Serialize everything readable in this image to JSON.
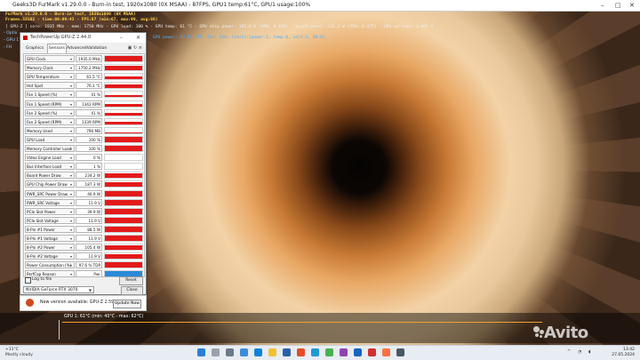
{
  "furmark": {
    "title": "Geeks3D FurMark v1.29.0.0 - Burn-in test, 1920x1080 (0X MSAA) - 87FPS, GPU1 temp:61°C, GPU1 usage:100%",
    "osd_line1": "FurMark v1.29.0.0 - Burn-in test, 1920x1080 (0X MSAA)",
    "osd_line2": "Frames:58102 - time:00:09:43 - FPS:87 (min:67, max:99, avg:86)",
    "osd_line3": "[ GPU-Z ] core: 1935 MHz - mem: 1750 MHz - GPU load: 100 % - GPU temp: 61 °C - GPU chip power: 185.8 W (PPW: 0.468) - Board power: 232.2 W (PPW: 0.375) - GPU voltage: 1.005 V",
    "osd_line4": "GPU power: 97.6% TDP, fan: 41%, limits:[power:1, temp:0, volt:1, OV:0]",
    "side_items": [
      "- Optix",
      "- GPU 1",
      "- FH"
    ],
    "temp_graph_label": "GPU 1: 61°C (min: 40°C - max: 62°C)"
  },
  "gpuz": {
    "title": "TechPowerUp GPU-Z 2.44.0",
    "tabs": [
      "Graphics Card",
      "Sensors",
      "Advanced",
      "Validation"
    ],
    "active_tab": "Sensors",
    "sensors": [
      {
        "label": "GPU Clock",
        "value": "1935.0 MHz",
        "fill": 0.92
      },
      {
        "label": "Memory Clock",
        "value": "1750.2 MHz",
        "fill": 0.9
      },
      {
        "label": "GPU Temperature",
        "value": "61.5 °C",
        "fill": 0.55
      },
      {
        "label": "Hot Spot",
        "value": "76.1 °C",
        "fill": 0.65
      },
      {
        "label": "Fan 1 Speed (%)",
        "value": "41 %",
        "fill": 0.4
      },
      {
        "label": "Fan 1 Speed (RPM)",
        "value": "1342 RPM",
        "fill": 0.4
      },
      {
        "label": "Fan 2 Speed (%)",
        "value": "41 %",
        "fill": 0.4
      },
      {
        "label": "Fan 2 Speed (RPM)",
        "value": "1339 RPM",
        "fill": 0.4
      },
      {
        "label": "Memory Used",
        "value": "790 MB",
        "fill": 0.12
      },
      {
        "label": "GPU Load",
        "value": "100 %",
        "fill": 1.0
      },
      {
        "label": "Memory Controller Load",
        "value": "100 %",
        "fill": 1.0
      },
      {
        "label": "Video Engine Load",
        "value": "0 %",
        "fill": 0.0
      },
      {
        "label": "Bus Interface Load",
        "value": "1 %",
        "fill": 0.0
      },
      {
        "label": "Board Power Draw",
        "value": "234.2 W",
        "fill": 0.96
      },
      {
        "label": "GPU Chip Power Draw",
        "value": "187.3 W",
        "fill": 0.93
      },
      {
        "label": "PWR_SRC Power Draw",
        "value": "46.9 W",
        "fill": 0.9
      },
      {
        "label": "PWR_SRC Voltage",
        "value": "11.9 V",
        "fill": 0.95
      },
      {
        "label": "PCIe Slot Power",
        "value": "39.9 W",
        "fill": 0.9
      },
      {
        "label": "PCIe Slot Voltage",
        "value": "11.9 V",
        "fill": 0.95
      },
      {
        "label": "8-Pin #1 Power",
        "value": "88.5 W",
        "fill": 0.92
      },
      {
        "label": "8-Pin #1 Voltage",
        "value": "11.9 V",
        "fill": 0.95
      },
      {
        "label": "8-Pin #2 Power",
        "value": "105.4 W",
        "fill": 0.93
      },
      {
        "label": "8-Pin #2 Voltage",
        "value": "11.9 V",
        "fill": 0.95
      },
      {
        "label": "Power Consumption (%)",
        "value": "97.6 % TDP",
        "fill": 0.97
      },
      {
        "label": "PerfCap Reason",
        "value": "Pwr",
        "fill": 1.0,
        "color": "#2a8ad8"
      }
    ],
    "log_label": "Log to file",
    "reset_label": "Reset",
    "gpu_select": "NVIDIA GeForce RTX 3070",
    "close_label": "Close"
  },
  "update": {
    "message": "New version available: GPU-Z 2.59.0",
    "button_label": "Update Now"
  },
  "watermark": "Avito",
  "taskbar": {
    "weather_temp": "+11°C",
    "weather_desc": "Mostly cloudy",
    "time": "13:42",
    "date": "27.05.2024"
  }
}
